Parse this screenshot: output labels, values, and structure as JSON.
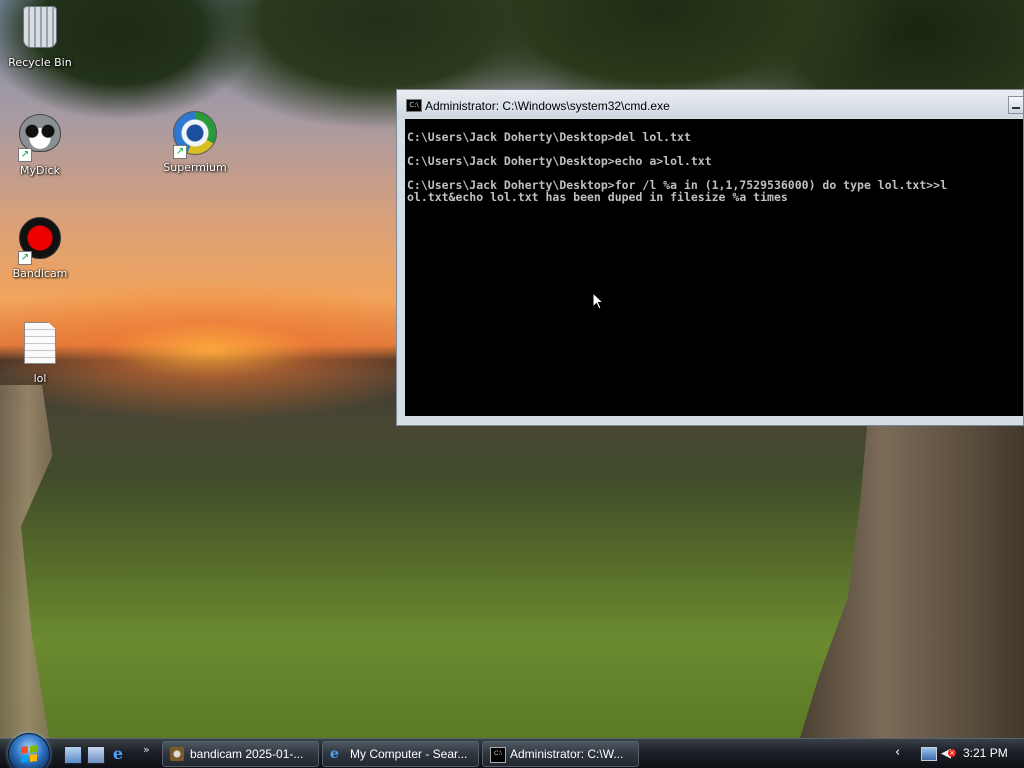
{
  "desktop": {
    "icons": [
      {
        "label": "Recycle Bin",
        "icon": "recycle-bin-icon"
      },
      {
        "label": "MyDick",
        "icon": "raccoon-icon"
      },
      {
        "label": "Supermium",
        "icon": "browser-globe-icon"
      },
      {
        "label": "Bandicam",
        "icon": "record-icon"
      },
      {
        "label": "lol",
        "icon": "text-file-icon"
      }
    ]
  },
  "cmd_window": {
    "title": "Administrator: C:\\Windows\\system32\\cmd.exe",
    "title_icon": "C:\\",
    "lines": [
      "C:\\Users\\Jack Doherty\\Desktop>del lol.txt",
      "",
      "C:\\Users\\Jack Doherty\\Desktop>echo a>lol.txt",
      "",
      "C:\\Users\\Jack Doherty\\Desktop>for /l %a in (1,1,7529536000) do type lol.txt>>l",
      "ol.txt&echo lol.txt has been duped in filesize %a times"
    ]
  },
  "taskbar": {
    "quick_launch": [
      "show-desktop-icon",
      "switch-windows-icon",
      "internet-explorer-icon"
    ],
    "more": "»",
    "buttons": [
      {
        "label": "bandicam 2025-01-...",
        "icon": "bandicam-folder-icon"
      },
      {
        "label": "My Computer - Sear...",
        "icon": "internet-explorer-icon"
      },
      {
        "label": "Administrator: C:\\W...",
        "icon": "cmd-icon"
      }
    ],
    "tray": {
      "chevron": "‹",
      "clock": "3:21 PM"
    }
  }
}
